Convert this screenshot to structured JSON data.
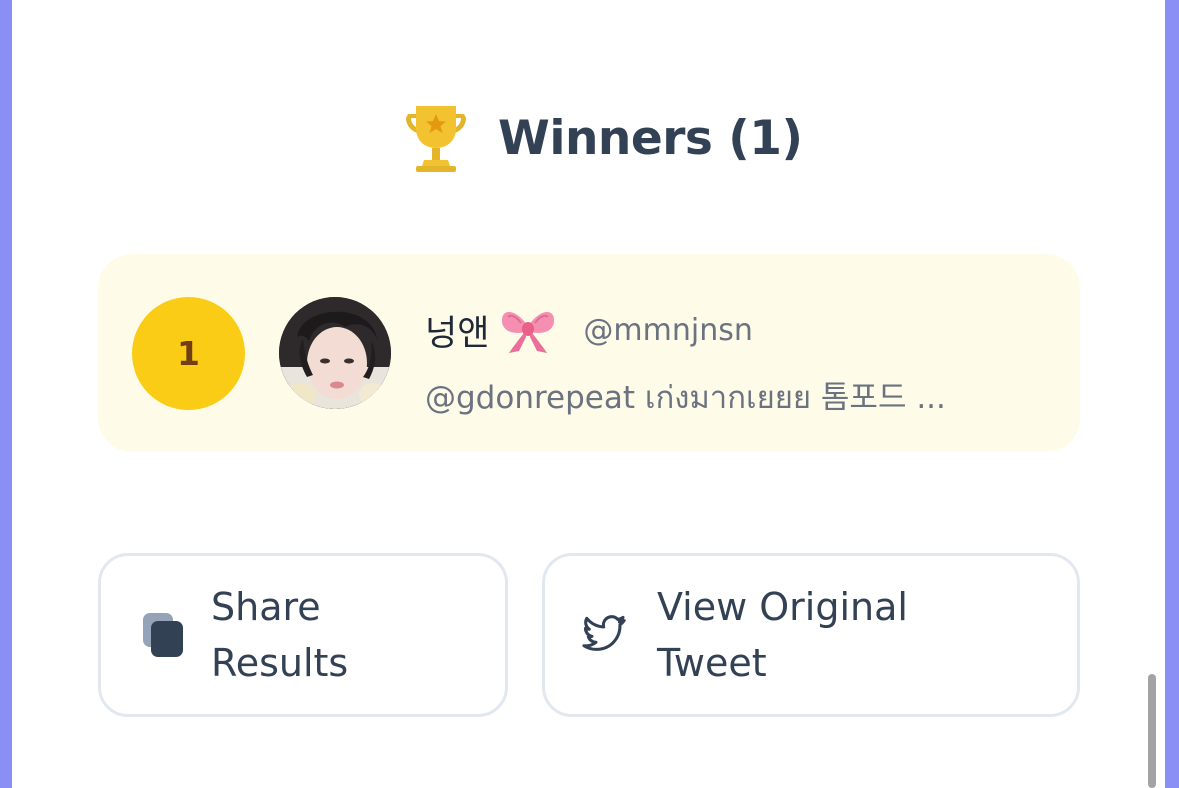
{
  "winners": {
    "heading": "Winners (1)",
    "icon": "trophy-icon"
  },
  "entries": [
    {
      "rank": "1",
      "display_name": "넝앤",
      "name_emoji": "ribbon-bow-icon",
      "handle": "@mmnjnsn",
      "reply_text": "@gdonrepeat เก่งมากเยยย 톰포드 ..."
    }
  ],
  "actions": {
    "share_label_line1": "Share",
    "share_label_line2": "Results",
    "view_label_line1": "View Original",
    "view_label_line2": "Tweet"
  },
  "colors": {
    "page_border": "#8a8ff5",
    "winner_row_bg": "#fefce8",
    "rank_badge": "#facc15",
    "text_primary": "#334155",
    "text_muted": "#6b7280"
  }
}
